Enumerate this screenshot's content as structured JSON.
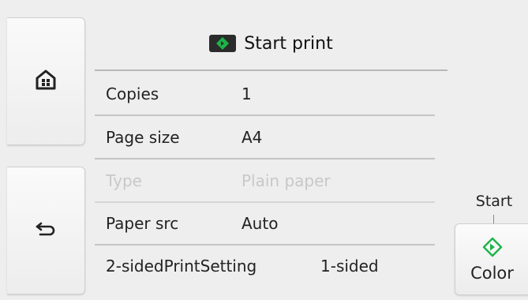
{
  "nav": {
    "home_icon": "home-icon",
    "back_icon": "back-arrow-icon"
  },
  "header": {
    "title": "Start print",
    "icon": "start-diamond-icon",
    "icon_color": "#1db34a"
  },
  "settings": [
    {
      "label": "Copies",
      "value": "1",
      "enabled": true
    },
    {
      "label": "Page size",
      "value": "A4",
      "enabled": true
    },
    {
      "label": "Type",
      "value": "Plain paper",
      "enabled": false
    },
    {
      "label": "Paper src",
      "value": "Auto",
      "enabled": true
    },
    {
      "label": "2-sidedPrintSetting",
      "value": "1-sided",
      "enabled": true
    }
  ],
  "start": {
    "label": "Start",
    "button_label": "Color",
    "icon": "start-diamond-icon",
    "icon_color": "#1db34a"
  }
}
